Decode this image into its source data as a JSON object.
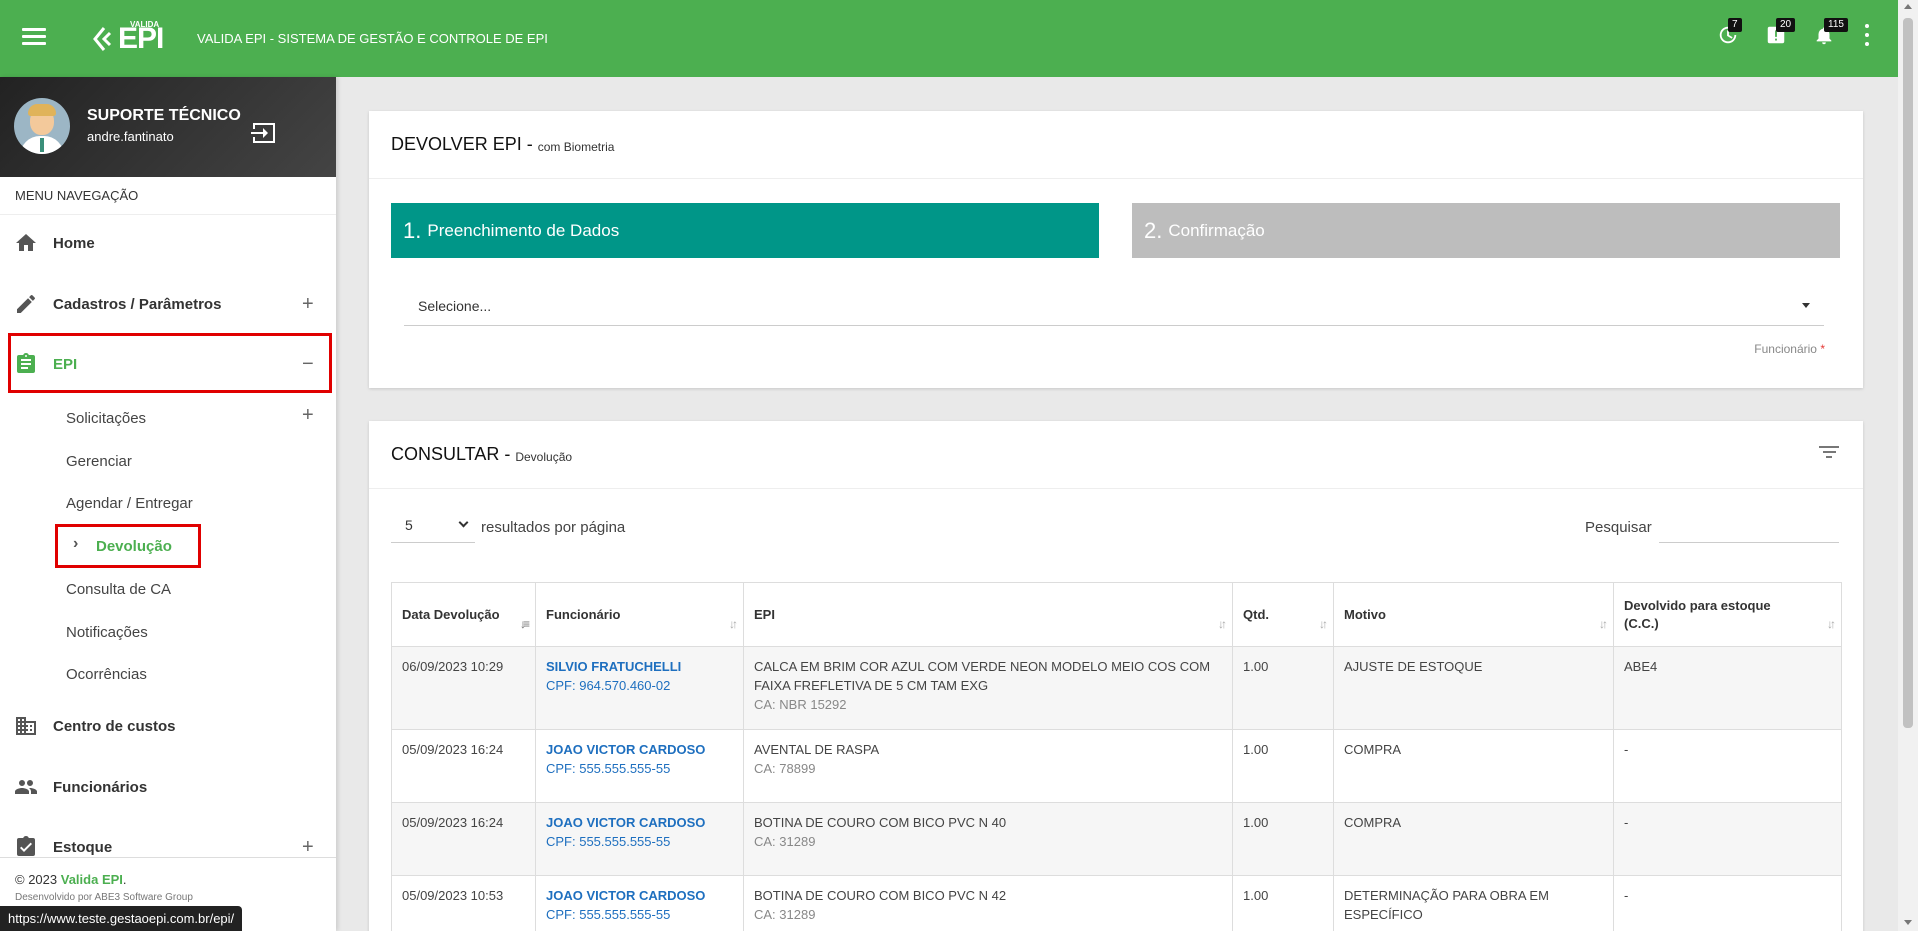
{
  "header": {
    "app_title": "VALIDA EPI - SISTEMA DE GESTÃO E CONTROLE DE EPI",
    "logo_small": "VALIDA",
    "logo_main": "EPI",
    "badges": {
      "history": "7",
      "alerts": "20",
      "notifications": "115"
    }
  },
  "user": {
    "name": "SUPORTE TÉCNICO",
    "login": "andre.fantinato"
  },
  "sidebar": {
    "menu_header": "MENU NAVEGAÇÃO",
    "items": [
      {
        "label": "Home"
      },
      {
        "label": "Cadastros / Parâmetros",
        "toggle": "+"
      },
      {
        "label": "EPI",
        "toggle": "−"
      },
      {
        "label": "Centro de custos"
      },
      {
        "label": "Funcionários"
      },
      {
        "label": "Estoque",
        "toggle": "+"
      }
    ],
    "epi_sub": [
      {
        "label": "Solicitações",
        "toggle": "+"
      },
      {
        "label": "Gerenciar"
      },
      {
        "label": "Agendar / Entregar"
      },
      {
        "label": "Devolução"
      },
      {
        "label": "Consulta de CA"
      },
      {
        "label": "Notificações"
      },
      {
        "label": "Ocorrências"
      }
    ],
    "footer": {
      "copyright": "© 2023",
      "brand": "Valida EPI",
      "dot": ".",
      "developed": "Desenvolvido por ABE3 Software Group"
    }
  },
  "status_url": "https://www.teste.gestaoepi.com.br/epi/",
  "devolver": {
    "title": "DEVOLVER EPI -",
    "subtitle": "com Biometria",
    "step1_num": "1.",
    "step1_label": "Preenchimento de Dados",
    "step2_num": "2.",
    "step2_label": "Confirmação",
    "select_placeholder": "Selecione...",
    "field_label": "Funcionário",
    "required_mark": "*"
  },
  "consultar": {
    "title": "CONSULTAR -",
    "subtitle": "Devolução",
    "per_page_value": "5",
    "per_page_label": "resultados por página",
    "search_label": "Pesquisar",
    "columns": [
      "Data Devolução",
      "Funcionário",
      "EPI",
      "Qtd.",
      "Motivo",
      "Devolvido para estoque (C.C.)"
    ],
    "rows": [
      {
        "date": "06/09/2023 10:29",
        "emp": "SILVIO FRATUCHELLI",
        "cpf": "CPF: 964.570.460-02",
        "epi": "CALCA EM BRIM COR AZUL COM VERDE NEON MODELO MEIO COS COM FAIXA FREFLETIVA DE 5 CM TAM EXG",
        "ca": "CA: NBR 15292",
        "qtd": "1.00",
        "motivo": "AJUSTE DE ESTOQUE",
        "estoque": "ABE4"
      },
      {
        "date": "05/09/2023 16:24",
        "emp": "JOAO VICTOR CARDOSO",
        "cpf": "CPF: 555.555.555-55",
        "epi": "AVENTAL DE RASPA",
        "ca": "CA: 78899",
        "qtd": "1.00",
        "motivo": "COMPRA",
        "estoque": "-"
      },
      {
        "date": "05/09/2023 16:24",
        "emp": "JOAO VICTOR CARDOSO",
        "cpf": "CPF: 555.555.555-55",
        "epi": "BOTINA DE COURO COM BICO PVC N 40",
        "ca": "CA: 31289",
        "qtd": "1.00",
        "motivo": "COMPRA",
        "estoque": "-"
      },
      {
        "date": "05/09/2023 10:53",
        "emp": "JOAO VICTOR CARDOSO",
        "cpf": "CPF: 555.555.555-55",
        "epi": "BOTINA DE COURO COM BICO PVC N 42",
        "ca": "CA: 31289",
        "qtd": "1.00",
        "motivo": "DETERMINAÇÃO PARA OBRA EM ESPECÍFICO",
        "estoque": "-"
      }
    ]
  },
  "colors": {
    "primary": "#4caf50",
    "step_active": "#009688",
    "step_inactive": "#bdbdbd",
    "highlight": "#e00000",
    "link": "#1e6fbf"
  }
}
